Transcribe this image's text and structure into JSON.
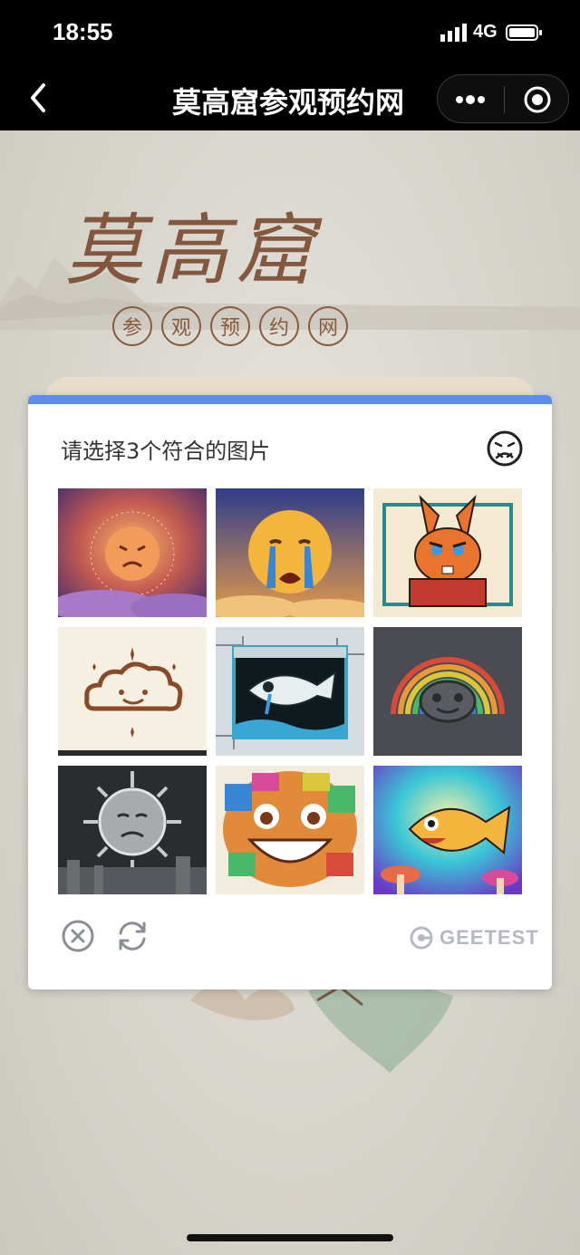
{
  "status_bar": {
    "time": "18:55",
    "network": "4G"
  },
  "nav_bar": {
    "title": "莫高窟参观预约网"
  },
  "background": {
    "logo_text": "莫高窟",
    "seal_chars": [
      "参",
      "观",
      "预",
      "约",
      "网"
    ]
  },
  "captcha": {
    "prompt": "请选择3个符合的图片",
    "tiles": [
      {
        "name": "angry-sun"
      },
      {
        "name": "crying-face"
      },
      {
        "name": "angry-rabbit"
      },
      {
        "name": "smiling-cloud"
      },
      {
        "name": "crying-fish"
      },
      {
        "name": "rainbow-face"
      },
      {
        "name": "crying-sun"
      },
      {
        "name": "pixel-smile"
      },
      {
        "name": "happy-fish"
      }
    ],
    "brand": "GEETEST"
  },
  "colors": {
    "accent": "#5b8df1",
    "nav_bg": "#000000",
    "logo": "#7a4a2e"
  },
  "icons": [
    "back-chevron-icon",
    "more-dots-icon",
    "target-icon",
    "angry-face-icon",
    "close-circle-icon",
    "refresh-icon",
    "geetest-logo-icon"
  ]
}
